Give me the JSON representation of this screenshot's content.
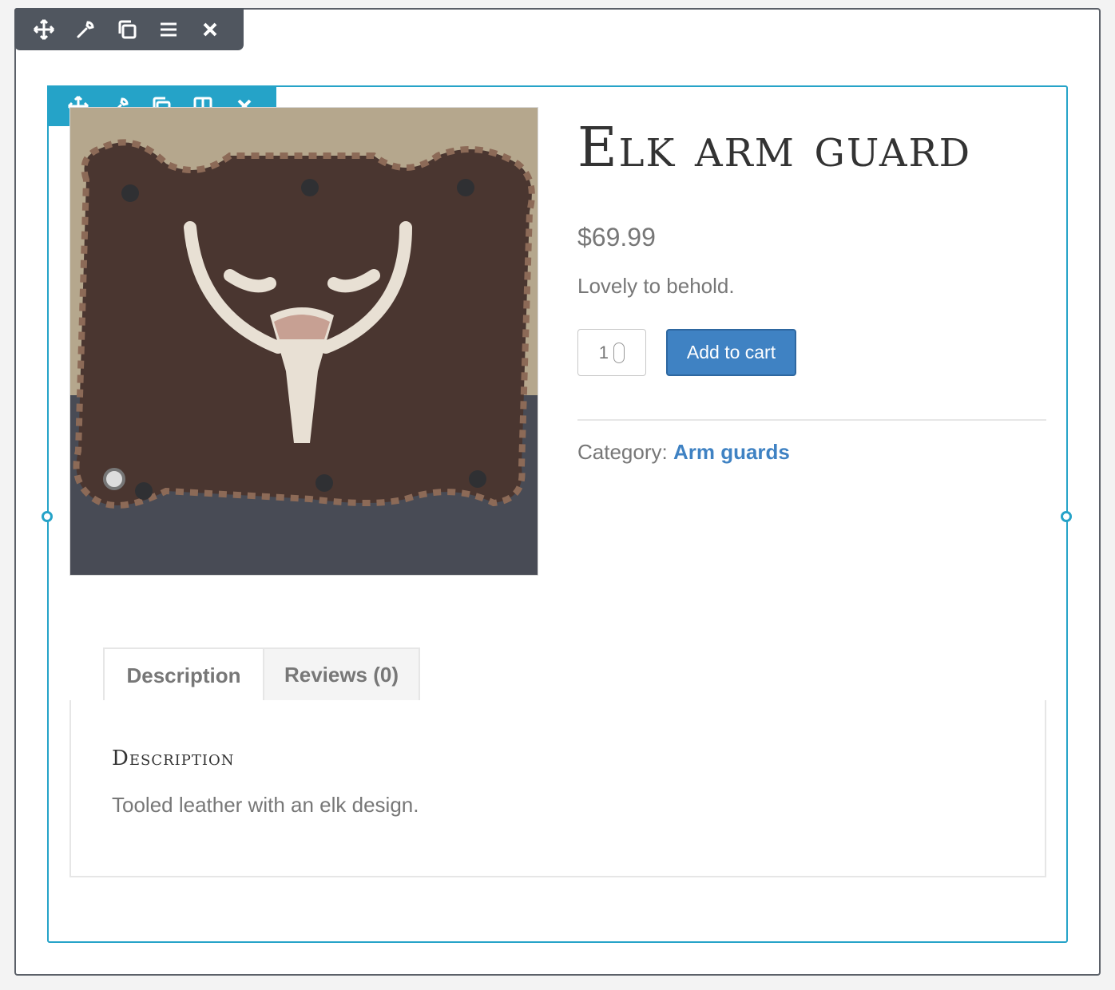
{
  "row_toolbar": {
    "icons": [
      "move-icon",
      "wrench-icon",
      "copy-icon",
      "menu-icon",
      "close-icon"
    ]
  },
  "column_toolbar": {
    "icons": [
      "move-icon",
      "wrench-icon",
      "copy-icon",
      "columns-icon",
      "close-icon"
    ]
  },
  "product": {
    "title": "Elk arm guard",
    "price": "$69.99",
    "short_description": "Lovely to behold.",
    "quantity": "1",
    "add_to_cart_label": "Add to cart",
    "category_label": "Category:",
    "category_link": "Arm guards"
  },
  "tabs": [
    {
      "label": "Description",
      "active": true
    },
    {
      "label": "Reviews (0)",
      "active": false
    }
  ],
  "description_panel": {
    "heading": "Description",
    "text": "Tooled leather with an elk design."
  },
  "colors": {
    "accent": "#25a3c8",
    "toolbar_dark": "#50565f",
    "button_blue": "#3f82c3",
    "text_gray": "#777777"
  }
}
